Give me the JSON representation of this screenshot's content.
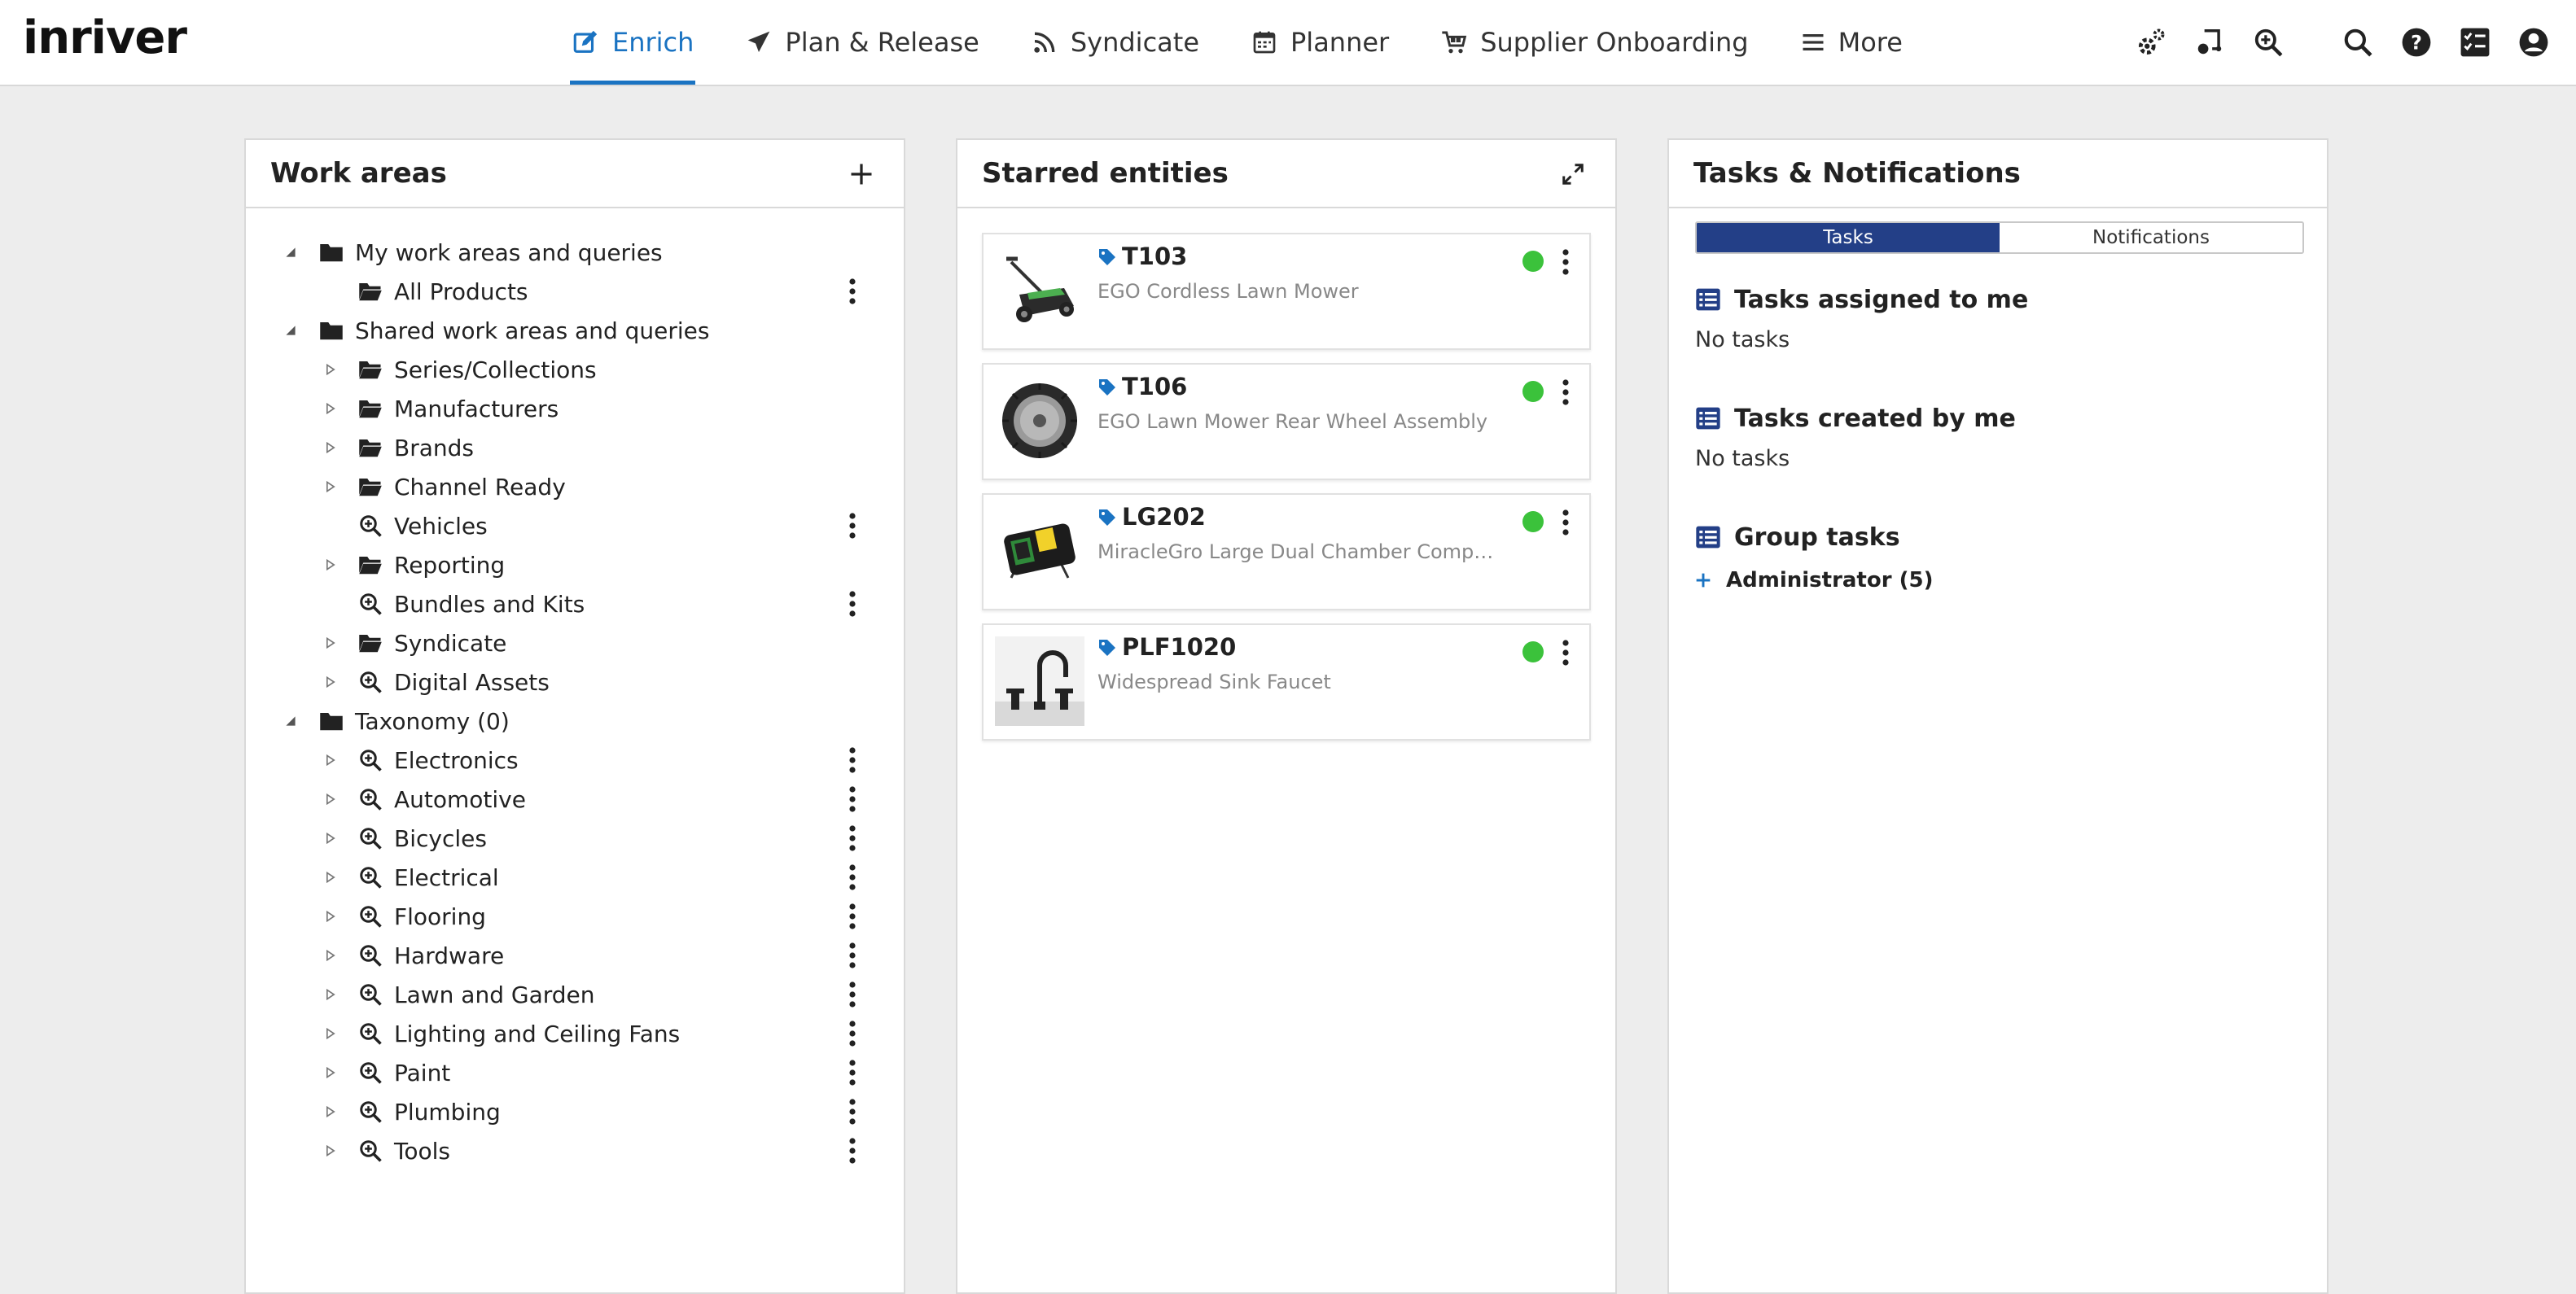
{
  "app": {
    "logo": "inriver"
  },
  "nav": {
    "items": [
      {
        "label": "Enrich",
        "icon": "edit-icon",
        "active": true
      },
      {
        "label": "Plan & Release",
        "icon": "send-icon"
      },
      {
        "label": "Syndicate",
        "icon": "rss-icon"
      },
      {
        "label": "Planner",
        "icon": "calendar-icon"
      },
      {
        "label": "Supplier Onboarding",
        "icon": "cart-icon"
      },
      {
        "label": "More",
        "icon": "hamburger-icon"
      }
    ]
  },
  "tools": [
    "settings-icon",
    "flow-icon",
    "zoom-icon",
    "search-icon",
    "help-icon",
    "checklist-icon",
    "user-icon"
  ],
  "work_areas": {
    "title": "Work areas",
    "items": [
      {
        "label": "My work areas and queries",
        "level": 0,
        "expander": "open",
        "icon": "folder-icon"
      },
      {
        "label": "All Products",
        "level": 1,
        "expander": "none",
        "icon": "folder-open-icon",
        "menu": true
      },
      {
        "label": "Shared work areas and queries",
        "level": 0,
        "expander": "open",
        "icon": "folder-icon"
      },
      {
        "label": "Series/Collections",
        "level": 1,
        "expander": "closed",
        "icon": "folder-open-icon"
      },
      {
        "label": "Manufacturers",
        "level": 1,
        "expander": "closed",
        "icon": "folder-open-icon"
      },
      {
        "label": "Brands",
        "level": 1,
        "expander": "closed",
        "icon": "folder-open-icon"
      },
      {
        "label": "Channel Ready",
        "level": 1,
        "expander": "closed",
        "icon": "folder-open-icon"
      },
      {
        "label": "Vehicles",
        "level": 1,
        "expander": "none",
        "icon": "query-icon",
        "menu": true
      },
      {
        "label": "Reporting",
        "level": 1,
        "expander": "closed",
        "icon": "folder-open-icon"
      },
      {
        "label": "Bundles and Kits",
        "level": 1,
        "expander": "none",
        "icon": "query-icon",
        "menu": true
      },
      {
        "label": "Syndicate",
        "level": 1,
        "expander": "closed",
        "icon": "folder-open-icon"
      },
      {
        "label": "Digital Assets",
        "level": 1,
        "expander": "closed",
        "icon": "query-icon"
      },
      {
        "label": "Taxonomy (0)",
        "level": 0,
        "expander": "open",
        "icon": "folder-icon"
      },
      {
        "label": "Electronics",
        "level": 1,
        "expander": "closed",
        "icon": "query-icon",
        "menu": true
      },
      {
        "label": "Automotive",
        "level": 1,
        "expander": "closed",
        "icon": "query-icon",
        "menu": true
      },
      {
        "label": "Bicycles",
        "level": 1,
        "expander": "closed",
        "icon": "query-icon",
        "menu": true
      },
      {
        "label": "Electrical",
        "level": 1,
        "expander": "closed",
        "icon": "query-icon",
        "menu": true
      },
      {
        "label": "Flooring",
        "level": 1,
        "expander": "closed",
        "icon": "query-icon",
        "menu": true
      },
      {
        "label": "Hardware",
        "level": 1,
        "expander": "closed",
        "icon": "query-icon",
        "menu": true
      },
      {
        "label": "Lawn and Garden",
        "level": 1,
        "expander": "closed",
        "icon": "query-icon",
        "menu": true
      },
      {
        "label": "Lighting and Ceiling Fans",
        "level": 1,
        "expander": "closed",
        "icon": "query-icon",
        "menu": true
      },
      {
        "label": "Paint",
        "level": 1,
        "expander": "closed",
        "icon": "query-icon",
        "menu": true
      },
      {
        "label": "Plumbing",
        "level": 1,
        "expander": "closed",
        "icon": "query-icon",
        "menu": true
      },
      {
        "label": "Tools",
        "level": 1,
        "expander": "closed",
        "icon": "query-icon",
        "menu": true
      }
    ]
  },
  "starred": {
    "title": "Starred entities",
    "items": [
      {
        "code": "T103",
        "desc": "EGO Cordless Lawn Mower",
        "thumb": "mower",
        "status_color": "#3bc23b"
      },
      {
        "code": "T106",
        "desc": "EGO Lawn Mower Rear Wheel Assembly",
        "thumb": "wheel",
        "status_color": "#3bc23b"
      },
      {
        "code": "LG202",
        "desc": "MiracleGro Large Dual Chamber Compost Tu...",
        "thumb": "composter",
        "status_color": "#3bc23b"
      },
      {
        "code": "PLF1020",
        "desc": "Widespread Sink Faucet",
        "thumb": "faucet",
        "status_color": "#3bc23b"
      }
    ]
  },
  "tasks": {
    "title": "Tasks & Notifications",
    "tabs": {
      "tasks": "Tasks",
      "notifications": "Notifications"
    },
    "assigned": {
      "title": "Tasks assigned to me",
      "body": "No tasks"
    },
    "created": {
      "title": "Tasks created by me",
      "body": "No tasks"
    },
    "group": {
      "title": "Group tasks",
      "item": "Administrator (5)"
    }
  },
  "colors": {
    "accent": "#1a73c2",
    "tab_active": "#233f87",
    "status_ok": "#3bc23b"
  }
}
